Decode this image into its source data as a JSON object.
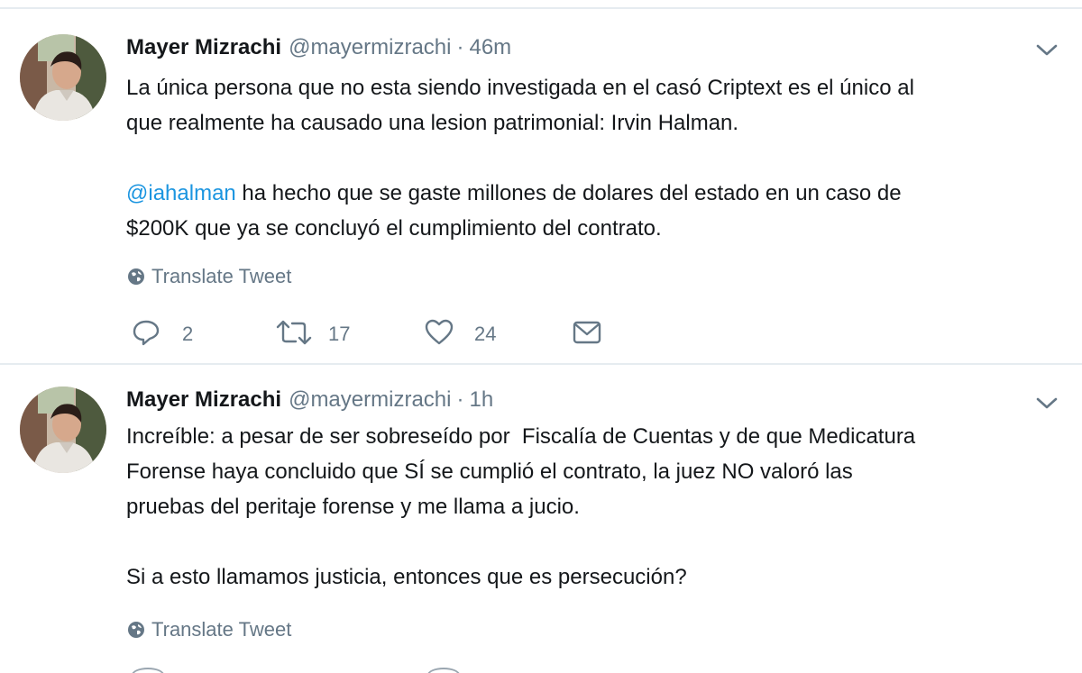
{
  "colors": {
    "text": "#14171a",
    "secondary": "#657786",
    "link": "#1b95e0",
    "separator": "#e6ecf0"
  },
  "tweets": [
    {
      "author": {
        "name": "Mayer Mizrachi",
        "handle": "@mayermizrachi",
        "separator": "·"
      },
      "time": "46m",
      "body": {
        "line1": "La única persona que no esta siendo investigada en el casó Criptext es el único al",
        "line2": "que realmente ha causado una lesion patrimonial: Irvin Halman.",
        "mention": "@iahalman",
        "line3_rest": " ha hecho que se gaste millones de dolares del estado en un caso de",
        "line4": "$200K que ya se concluyó el cumplimiento del contrato."
      },
      "translate_label": "Translate Tweet",
      "stats": {
        "replies": "2",
        "retweets": "17",
        "likes": "24"
      },
      "icons": [
        "reply-icon",
        "retweet-icon",
        "like-icon",
        "direct-message-icon",
        "caret-down-icon",
        "globe-icon"
      ]
    },
    {
      "author": {
        "name": "Mayer Mizrachi",
        "handle": "@mayermizrachi",
        "separator": "·"
      },
      "time": "1h",
      "body": {
        "line1": "Increíble: a pesar de ser sobreseído por  Fiscalía de Cuentas y de que Medicatura",
        "line2": "Forense haya concluido que SÍ se cumplió el contrato, la juez NO valoró las",
        "line3": "pruebas del peritaje forense y me llama a jucio.",
        "line4": "Si a esto llamamos justicia, entonces que es persecución?"
      },
      "translate_label": "Translate Tweet",
      "icons": [
        "caret-down-icon",
        "globe-icon"
      ]
    }
  ]
}
